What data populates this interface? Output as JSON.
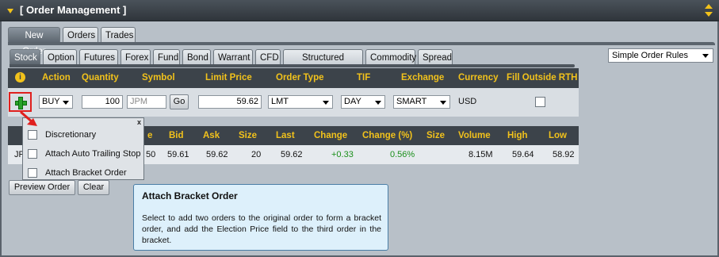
{
  "panel": {
    "title": "[ Order Management ]"
  },
  "main_tabs": [
    "New Order",
    "Orders",
    "Trades"
  ],
  "asset_tabs": [
    "Stock",
    "Option",
    "Futures",
    "Forex",
    "Fund",
    "Bond",
    "Warrant",
    "CFD",
    "Structured Product",
    "Commodity",
    "Spread"
  ],
  "rules_select": {
    "value": "Simple Order Rules"
  },
  "order_header": {
    "info": "i",
    "action": "Action",
    "quantity": "Quantity",
    "symbol": "Symbol",
    "limit_price": "Limit Price",
    "order_type": "Order Type",
    "tif": "TIF",
    "exchange": "Exchange",
    "currency": "Currency",
    "fill_outside_rth": "Fill Outside RTH"
  },
  "order_row": {
    "action": "BUY",
    "quantity": "100",
    "symbol_placeholder": "JPM",
    "go": "Go",
    "limit_price": "59.62",
    "order_type": "LMT",
    "tif": "DAY",
    "exchange": "SMART",
    "currency": "USD"
  },
  "market_header": {
    "partial_col": "e",
    "bid": "Bid",
    "ask": "Ask",
    "size": "Size",
    "last": "Last",
    "change": "Change",
    "change_pct": "Change (%)",
    "size2": "Size",
    "volume": "Volume",
    "high": "High",
    "low": "Low"
  },
  "market_row": {
    "symbol_partial": "JP",
    "partial_val": "50",
    "bid": "59.61",
    "ask": "59.62",
    "size": "20",
    "last": "59.62",
    "change": "+0.33",
    "change_pct": "0.56%",
    "volume": "8.15M",
    "high": "59.64",
    "low": "58.92"
  },
  "buttons": {
    "preview": "Preview Order",
    "clear": "Clear"
  },
  "popup": {
    "close": "x",
    "items": [
      "Discretionary",
      "Attach Auto Trailing Stop",
      "Attach Bracket Order"
    ]
  },
  "tooltip": {
    "title": "Attach Bracket Order",
    "body": "Select to add two orders to the original order to form a bracket order, and add the Election Price field to the third order in the bracket."
  },
  "colors": {
    "accent": "#f2c21b",
    "header_bg": "#3c434a",
    "highlight": "#e0201e",
    "positive": "#1a8f1a"
  }
}
